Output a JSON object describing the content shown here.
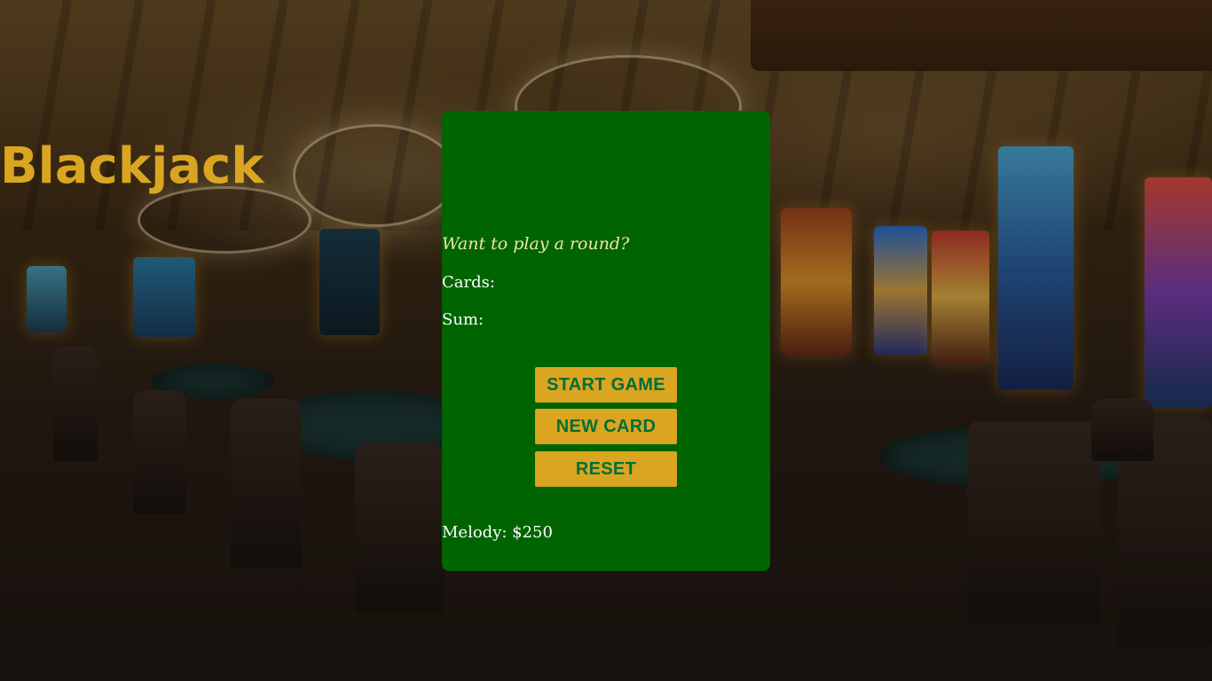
{
  "game": {
    "title": "Blackjack",
    "message": "Want to play a round?",
    "cards_label": "Cards:",
    "sum_label": "Sum:",
    "buttons": {
      "start": "START GAME",
      "new_card": "NEW CARD",
      "reset": "RESET"
    },
    "player": "Melody: $250"
  },
  "colors": {
    "panel": "#006400",
    "accent": "#daa520",
    "button_text": "#016f34",
    "message_text": "#f0e6a8",
    "info_text": "#ffffff"
  }
}
